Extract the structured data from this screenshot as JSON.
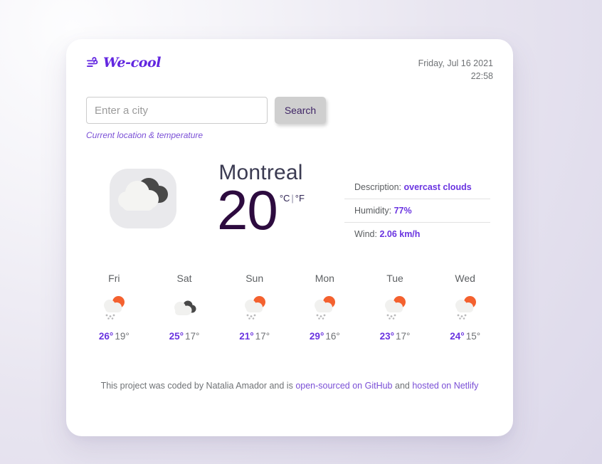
{
  "header": {
    "logo_icon": "wind-icon",
    "logo_text": "We-cool",
    "date": "Friday, Jul 16 2021",
    "time": "22:58"
  },
  "search": {
    "placeholder": "Enter a city",
    "value": "",
    "button_label": "Search",
    "current_location_link": "Current location & temperature"
  },
  "current": {
    "icon": "overcast-clouds-icon",
    "city": "Montreal",
    "temperature": "20",
    "unit_celsius": "°C",
    "unit_separator": "|",
    "unit_fahrenheit": "°F",
    "details": [
      {
        "label": "Description:",
        "value": "overcast clouds"
      },
      {
        "label": "Humidity:",
        "value": "77%"
      },
      {
        "label": "Wind:",
        "value": "2.06 km/h"
      }
    ]
  },
  "forecast": [
    {
      "day": "Fri",
      "icon": "sun-rain-icon",
      "max": "26°",
      "min": "19°"
    },
    {
      "day": "Sat",
      "icon": "broken-clouds-icon",
      "max": "25°",
      "min": "17°"
    },
    {
      "day": "Sun",
      "icon": "sun-rain-icon",
      "max": "21°",
      "min": "17°"
    },
    {
      "day": "Mon",
      "icon": "sun-rain-icon",
      "max": "29°",
      "min": "16°"
    },
    {
      "day": "Tue",
      "icon": "sun-rain-icon",
      "max": "23°",
      "min": "17°"
    },
    {
      "day": "Wed",
      "icon": "sun-rain-icon",
      "max": "24°",
      "min": "15°"
    }
  ],
  "footer": {
    "text_before": "This project was coded by Natalia Amador and is ",
    "link_github": "open-sourced on GitHub",
    "text_middle": " and ",
    "link_netlify": "hosted on Netlify"
  },
  "colors": {
    "accent": "#6a34e0",
    "link": "#7a4fd6",
    "temp": "#2d0b3f",
    "muted": "#6f7275",
    "button_bg": "#cfcfcf",
    "sun": "#f4612f",
    "cloud_dark": "#4a4a4a",
    "cloud_light": "#f2f2f2"
  }
}
